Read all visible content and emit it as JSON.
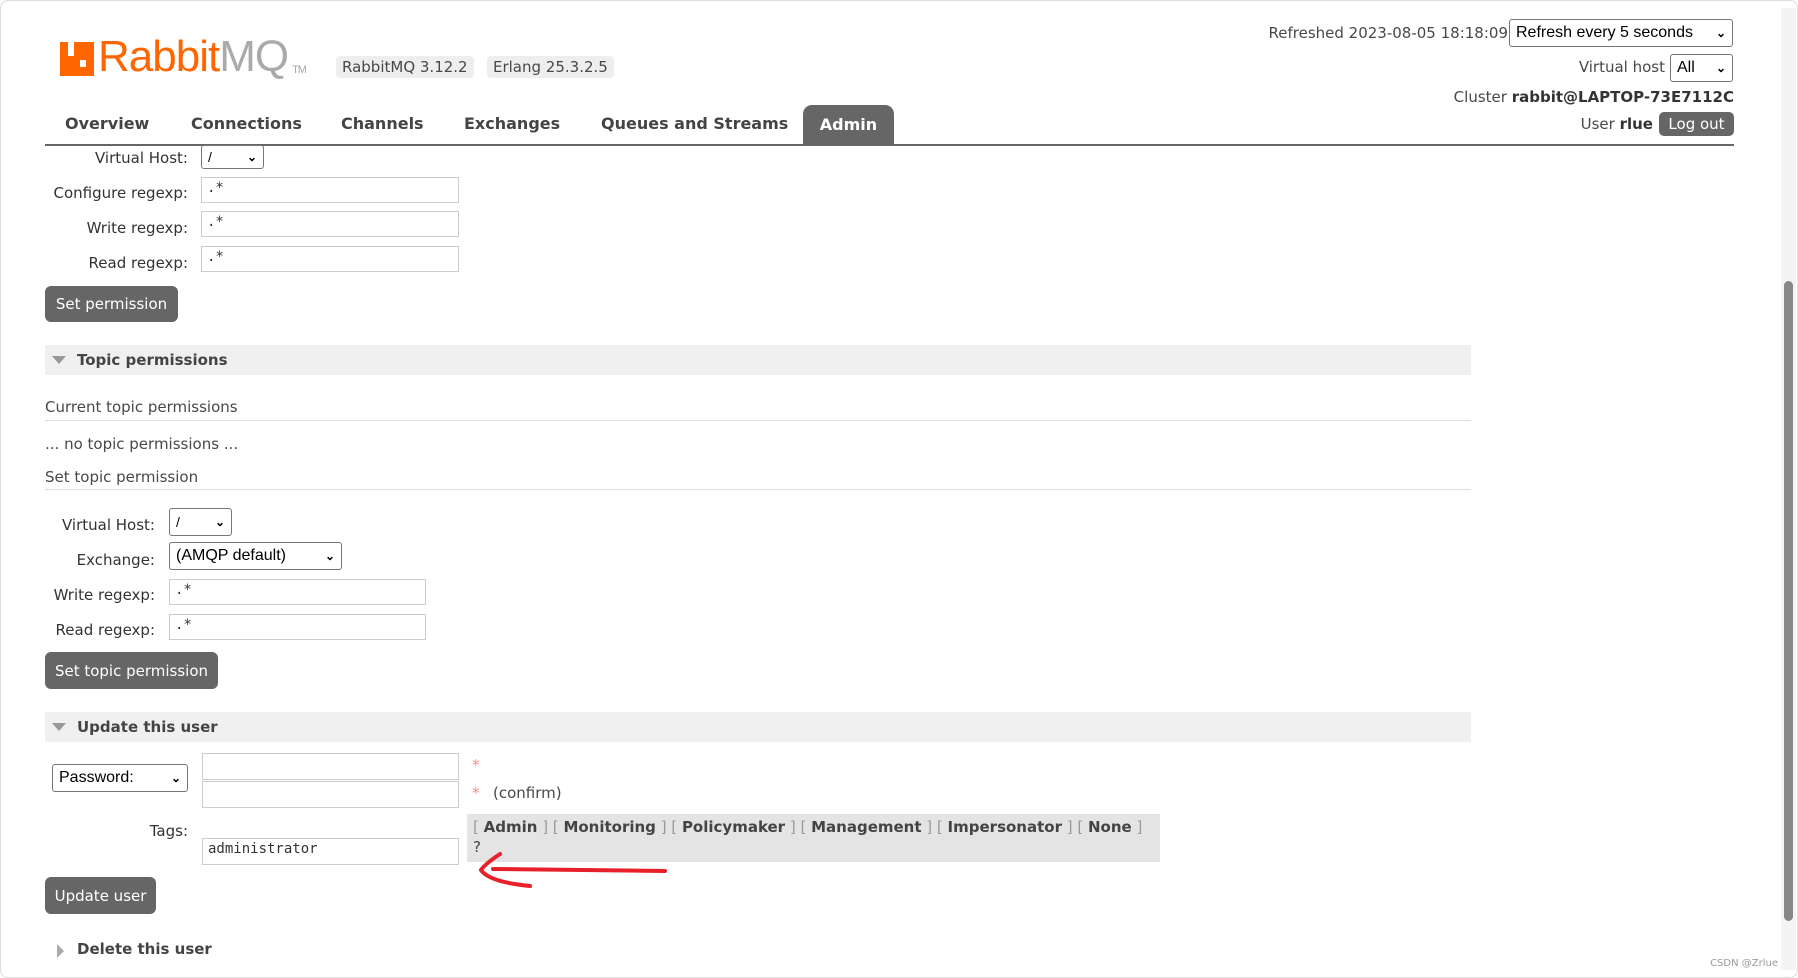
{
  "header": {
    "logo_rabbit": "Rabbit",
    "logo_mq": "MQ",
    "logo_tm": "TM",
    "version": "RabbitMQ 3.12.2",
    "erlang": "Erlang 25.3.2.5",
    "refreshed": "Refreshed 2023-08-05 18:18:09",
    "refresh_select": "Refresh every 5 seconds",
    "vhost_label": "Virtual host",
    "vhost_select": "All",
    "cluster_label": "Cluster",
    "cluster_value": "rabbit@LAPTOP-73E7112C",
    "user_label": "User",
    "user_value": "rlue",
    "logout": "Log out"
  },
  "tabs": [
    {
      "label": "Overview"
    },
    {
      "label": "Connections"
    },
    {
      "label": "Channels"
    },
    {
      "label": "Exchanges"
    },
    {
      "label": "Queues and Streams"
    },
    {
      "label": "Admin",
      "active": true
    }
  ],
  "permissions": {
    "vhost_label": "Virtual Host:",
    "vhost_value": "/",
    "configure_label": "Configure regexp:",
    "configure_value": ".*",
    "write_label": "Write regexp:",
    "write_value": ".*",
    "read_label": "Read regexp:",
    "read_value": ".*",
    "button": "Set permission"
  },
  "topic": {
    "title": "Topic permissions",
    "current": "Current topic permissions",
    "empty": "... no topic permissions ...",
    "set": "Set topic permission",
    "vhost_label": "Virtual Host:",
    "vhost_value": "/",
    "exchange_label": "Exchange:",
    "exchange_value": "(AMQP default)",
    "write_label": "Write regexp:",
    "write_value": ".*",
    "read_label": "Read regexp:",
    "read_value": ".*",
    "button": "Set topic permission"
  },
  "update": {
    "title": "Update this user",
    "password_select": "Password:",
    "password": "",
    "confirm": "",
    "asterisk": "*",
    "confirm_label": "(confirm)",
    "tags_label": "Tags:",
    "tags_value": "administrator",
    "tag_options": [
      "Admin",
      "Monitoring",
      "Policymaker",
      "Management",
      "Impersonator",
      "None"
    ],
    "help": "?",
    "button": "Update user"
  },
  "delete": {
    "title": "Delete this user"
  },
  "annotation_color": "#e8202a",
  "watermark": "CSDN @Zrlue"
}
